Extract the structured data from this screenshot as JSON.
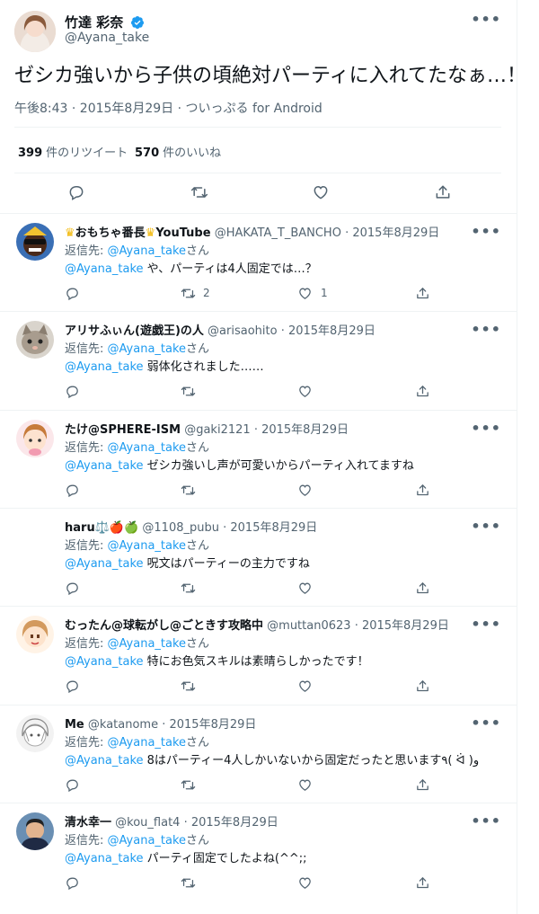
{
  "main_tweet": {
    "display_name": "竹達 彩奈",
    "handle": "@Ayana_take",
    "text": "ゼシカ強いから子供の頃絶対パーティに入れてたなぁ…！",
    "meta": "午後8:43 · 2015年8月29日 · ついっぷる for Android",
    "retweet_count": "399",
    "retweet_label": "件のリツイート",
    "like_count": "570",
    "like_label": "件のいいね",
    "more_icon": "more-icon"
  },
  "replies": [
    {
      "display_name": "おもちゃ番長",
      "display_suffix": "YouTube",
      "handle": "@HAKATA_T_BANCHO",
      "date": "· 2015年8月29日",
      "reply_to_label": "返信先:",
      "reply_to": "@Ayana_take",
      "reply_to_suffix": "さん",
      "mention": "@Ayana_take",
      "text": "や、パーティは4人固定では…？",
      "retweets": "2",
      "likes": "1"
    },
    {
      "display_name": "アリサふぃん(遊戯王)の人",
      "handle": "@arisaohito",
      "date": "· 2015年8月29日",
      "reply_to_label": "返信先:",
      "reply_to": "@Ayana_take",
      "reply_to_suffix": "さん",
      "mention": "@Ayana_take",
      "text": "弱体化されました……"
    },
    {
      "display_name": "たけ@SPHERE-ISM",
      "handle": "@gaki2121",
      "date": "· 2015年8月29日",
      "reply_to_label": "返信先:",
      "reply_to": "@Ayana_take",
      "reply_to_suffix": "さん",
      "mention": "@Ayana_take",
      "text": "ゼシカ強いし声が可愛いからパーティ入れてますね"
    },
    {
      "display_name": "haru⚖️🍎🍏",
      "handle": "@1108_pubu",
      "date": "· 2015年8月29日",
      "reply_to_label": "返信先:",
      "reply_to": "@Ayana_take",
      "reply_to_suffix": "さん",
      "mention": "@Ayana_take",
      "text": "呪文はパーティーの主力ですね"
    },
    {
      "display_name": "むったん@球転がし@ごときす攻略中",
      "handle": "@muttan0623",
      "date": "· 2015年8月29日",
      "reply_to_label": "返信先:",
      "reply_to": "@Ayana_take",
      "reply_to_suffix": "さん",
      "mention": "@Ayana_take",
      "text": "特にお色気スキルは素晴らしかったです！"
    },
    {
      "display_name": "Me",
      "handle": "@katanome",
      "date": "· 2015年8月29日",
      "reply_to_label": "返信先:",
      "reply_to": "@Ayana_take",
      "reply_to_suffix": "さん",
      "mention": "@Ayana_take",
      "text": "8はパーティー4人しかいないから固定だったと思います٩( ᐛ )و"
    },
    {
      "display_name": "清水幸一",
      "handle": "@kou_flat4",
      "date": "· 2015年8月29日",
      "reply_to_label": "返信先:",
      "reply_to": "@Ayana_take",
      "reply_to_suffix": "さん",
      "mention": "@Ayana_take",
      "text": "パーティ固定でしたよね(^^;;"
    }
  ],
  "colors": {
    "accent": "#1d9bf0",
    "secondary_text": "#536471",
    "border": "#eff3f4"
  }
}
